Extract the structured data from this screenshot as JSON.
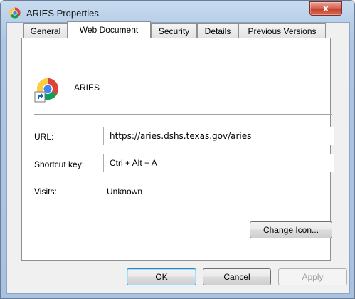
{
  "window": {
    "title": "ARIES Properties",
    "close_label": "x"
  },
  "tabs": [
    {
      "label": "General"
    },
    {
      "label": "Web Document"
    },
    {
      "label": "Security"
    },
    {
      "label": "Details"
    },
    {
      "label": "Previous Versions"
    }
  ],
  "active_tab": "Web Document",
  "panel": {
    "app_name": "ARIES",
    "app_icon": "chrome-shortcut-icon",
    "url_label": "URL:",
    "url_value": "https://aries.dshs.texas.gov/aries",
    "shortcut_label": "Shortcut key:",
    "shortcut_value": "Ctrl + Alt + A",
    "visits_label": "Visits:",
    "visits_value": "Unknown",
    "change_icon_label": "Change Icon..."
  },
  "buttons": {
    "ok": "OK",
    "cancel": "Cancel",
    "apply": "Apply"
  },
  "colors": {
    "accent": "#3c7fb1",
    "frame": "#a9c2e2",
    "close": "#c6402c"
  }
}
